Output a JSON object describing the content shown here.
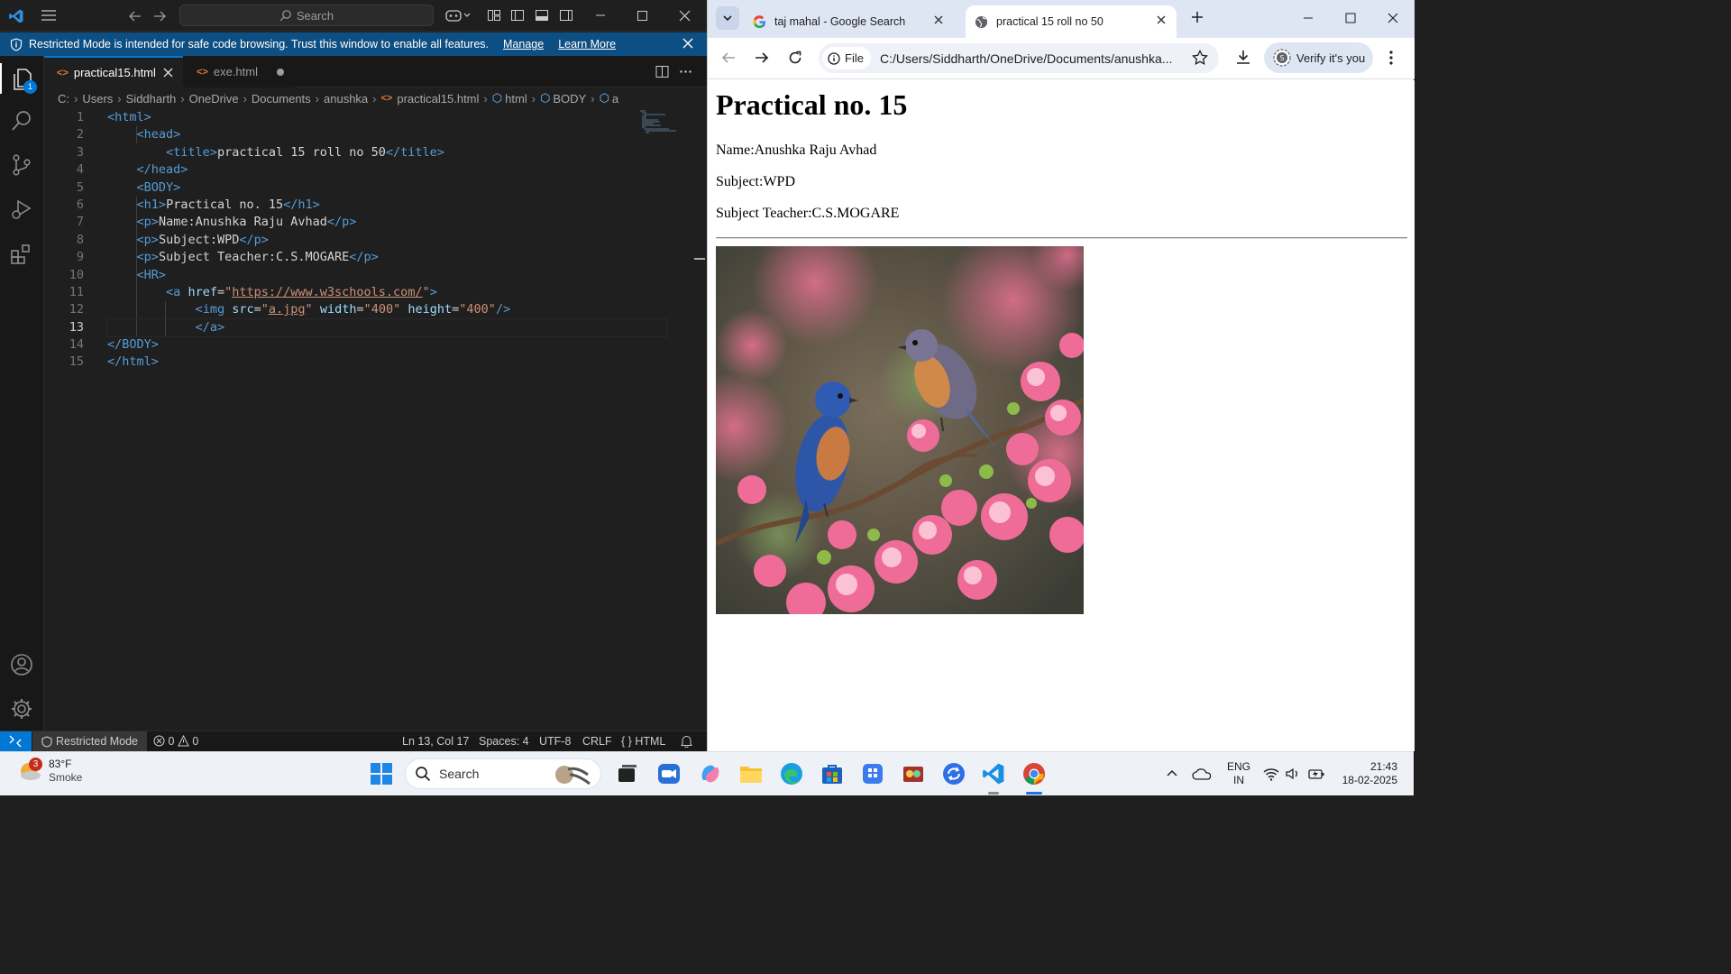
{
  "vscode": {
    "search_placeholder": "Search",
    "banner": {
      "message": "Restricted Mode is intended for safe code browsing. Trust this window to enable all features.",
      "manage": "Manage",
      "learn_more": "Learn More"
    },
    "explorer_badge": "1",
    "tabs": [
      {
        "label": "practical15.html",
        "active": true
      },
      {
        "label": "exe.html",
        "active": false
      }
    ],
    "breadcrumb": [
      "C:",
      "Users",
      "Siddharth",
      "OneDrive",
      "Documents",
      "anushka",
      "practical15.html",
      "html",
      "BODY",
      "a"
    ],
    "line_numbers": [
      "1",
      "2",
      "3",
      "4",
      "5",
      "6",
      "7",
      "8",
      "9",
      "10",
      "11",
      "12",
      "13",
      "14",
      "15"
    ],
    "current_line": "13",
    "status": {
      "restricted": "Restricted Mode",
      "errors": "0",
      "warnings": "0",
      "position": "Ln 13, Col 17",
      "spaces": "Spaces: 4",
      "encoding": "UTF-8",
      "eol": "CRLF",
      "language": "HTML"
    }
  },
  "code_lines": [
    [
      [
        "tg",
        "<"
      ],
      [
        "tn",
        "html"
      ],
      [
        "tg",
        ">"
      ]
    ],
    [
      [
        "sp",
        "    "
      ],
      [
        "tg",
        "<"
      ],
      [
        "tn",
        "head"
      ],
      [
        "tg",
        ">"
      ]
    ],
    [
      [
        "sp",
        "        "
      ],
      [
        "tg",
        "<"
      ],
      [
        "tn",
        "title"
      ],
      [
        "tg",
        ">"
      ],
      [
        "tx",
        "practical 15 roll no 50"
      ],
      [
        "tg",
        "</"
      ],
      [
        "tn",
        "title"
      ],
      [
        "tg",
        ">"
      ]
    ],
    [
      [
        "sp",
        "    "
      ],
      [
        "tg",
        "</"
      ],
      [
        "tn",
        "head"
      ],
      [
        "tg",
        ">"
      ]
    ],
    [
      [
        "sp",
        "    "
      ],
      [
        "tg",
        "<"
      ],
      [
        "tn",
        "BODY"
      ],
      [
        "tg",
        ">"
      ]
    ],
    [
      [
        "sp",
        "    "
      ],
      [
        "tg",
        "<"
      ],
      [
        "tn",
        "h1"
      ],
      [
        "tg",
        ">"
      ],
      [
        "tx",
        "Practical no. 15"
      ],
      [
        "tg",
        "</"
      ],
      [
        "tn",
        "h1"
      ],
      [
        "tg",
        ">"
      ]
    ],
    [
      [
        "sp",
        "    "
      ],
      [
        "tg",
        "<"
      ],
      [
        "tn",
        "p"
      ],
      [
        "tg",
        ">"
      ],
      [
        "tx",
        "Name:Anushka Raju Avhad"
      ],
      [
        "tg",
        "</"
      ],
      [
        "tn",
        "p"
      ],
      [
        "tg",
        ">"
      ]
    ],
    [
      [
        "sp",
        "    "
      ],
      [
        "tg",
        "<"
      ],
      [
        "tn",
        "p"
      ],
      [
        "tg",
        ">"
      ],
      [
        "tx",
        "Subject:WPD"
      ],
      [
        "tg",
        "</"
      ],
      [
        "tn",
        "p"
      ],
      [
        "tg",
        ">"
      ]
    ],
    [
      [
        "sp",
        "    "
      ],
      [
        "tg",
        "<"
      ],
      [
        "tn",
        "p"
      ],
      [
        "tg",
        ">"
      ],
      [
        "tx",
        "Subject Teacher:C.S.MOGARE"
      ],
      [
        "tg",
        "</"
      ],
      [
        "tn",
        "p"
      ],
      [
        "tg",
        ">"
      ]
    ],
    [
      [
        "sp",
        "    "
      ],
      [
        "tg",
        "<"
      ],
      [
        "tn",
        "HR"
      ],
      [
        "tg",
        ">"
      ]
    ],
    [
      [
        "sp",
        "        "
      ],
      [
        "tg",
        "<"
      ],
      [
        "tn",
        "a"
      ],
      [
        "tx",
        " "
      ],
      [
        "at",
        "href"
      ],
      [
        "tx",
        "="
      ],
      [
        "sv",
        "\""
      ],
      [
        "svu",
        "https://www.w3schools.com/"
      ],
      [
        "sv",
        "\""
      ],
      [
        "tg",
        ">"
      ]
    ],
    [
      [
        "sp",
        "            "
      ],
      [
        "tg",
        "<"
      ],
      [
        "tn",
        "img"
      ],
      [
        "tx",
        " "
      ],
      [
        "at",
        "src"
      ],
      [
        "tx",
        "="
      ],
      [
        "sv",
        "\""
      ],
      [
        "svu",
        "a.jpg"
      ],
      [
        "sv",
        "\""
      ],
      [
        "tx",
        " "
      ],
      [
        "at",
        "width"
      ],
      [
        "tx",
        "="
      ],
      [
        "sv",
        "\"400\""
      ],
      [
        "tx",
        " "
      ],
      [
        "at",
        "height"
      ],
      [
        "tx",
        "="
      ],
      [
        "sv",
        "\"400\""
      ],
      [
        "tg",
        "/>"
      ]
    ],
    [
      [
        "sp",
        "            "
      ],
      [
        "tg",
        "</"
      ],
      [
        "tn",
        "a"
      ],
      [
        "tg",
        ">"
      ]
    ],
    [
      [
        "tg",
        "</"
      ],
      [
        "tn",
        "BODY"
      ],
      [
        "tg",
        ">"
      ]
    ],
    [
      [
        "tg",
        "</"
      ],
      [
        "tn",
        "html"
      ],
      [
        "tg",
        ">"
      ]
    ]
  ],
  "chrome": {
    "tabs": [
      {
        "title": "taj mahal - Google Search",
        "active": false
      },
      {
        "title": "practical 15 roll no 50",
        "active": true
      }
    ],
    "file_chip": "File",
    "url": "C:/Users/Siddharth/OneDrive/Documents/anushka...",
    "verify": "Verify it's you"
  },
  "webpage": {
    "heading": "Practical no. 15",
    "name": "Name:Anushka Raju Avhad",
    "subject": "Subject:WPD",
    "teacher": "Subject Teacher:C.S.MOGARE"
  },
  "taskbar": {
    "weather_temp": "83°F",
    "weather_desc": "Smoke",
    "weather_badge": "3",
    "search": "Search",
    "lang_1": "ENG",
    "lang_2": "IN",
    "time": "21:43",
    "date": "18-02-2025"
  },
  "colors": {
    "vscode_accent": "#0078d4",
    "banner": "#0e4f83",
    "chrome_tabstrip": "#dfe6f3",
    "html_tag": "#569cd6",
    "html_attr": "#9cdcfe",
    "html_string": "#ce9178"
  }
}
